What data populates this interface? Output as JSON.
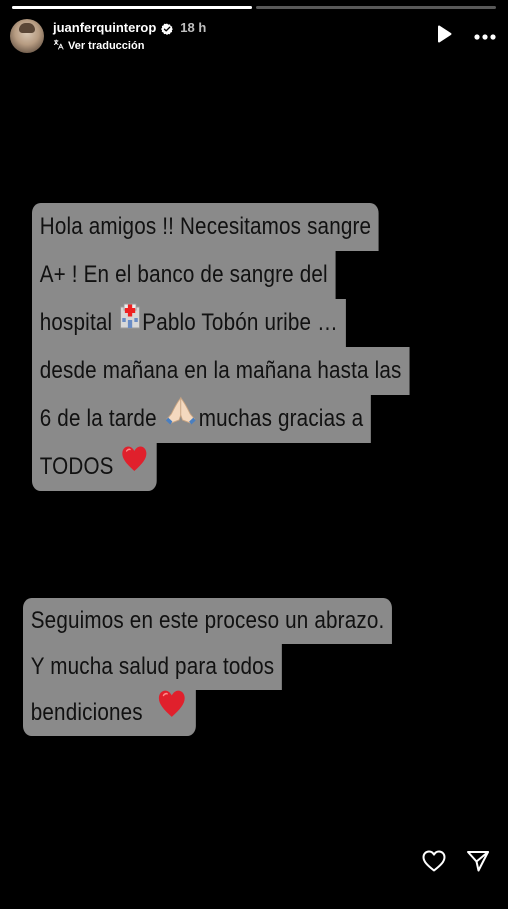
{
  "progress": [
    {
      "state": "viewed",
      "fill": 1.0
    },
    {
      "state": "current",
      "fill": 0.0
    }
  ],
  "header": {
    "username": "juanferquinterop",
    "verified": true,
    "time": "18 h",
    "translate_label": "Ver traducción",
    "play_icon": "play-icon",
    "more_icon": "more-options-icon"
  },
  "bubble1": {
    "lines": [
      "Hola amigos !! Necesitamos sangre",
      "A+ ! En el banco de sangre del",
      "hospital",
      "Pablo Tobón uribe …",
      "desde mañana en la mañana hasta las",
      "6 de la tarde",
      "muchas gracias a",
      "TODOS"
    ],
    "emojis": [
      "hospital-emoji",
      "praying-hands-emoji",
      "red-heart-emoji"
    ]
  },
  "bubble2": {
    "lines": [
      "Seguimos en este proceso un abrazo.",
      "Y mucha salud para todos",
      "bendiciones"
    ],
    "emojis": [
      "red-heart-emoji"
    ]
  },
  "footer": {
    "like_icon": "heart-outline-icon",
    "share_icon": "send-icon"
  },
  "colors": {
    "background": "#000000",
    "bubble": "#8a8a8a",
    "bubble_text": "#111111",
    "heart": "#e0202c",
    "verified_badge": "#ffffff"
  }
}
